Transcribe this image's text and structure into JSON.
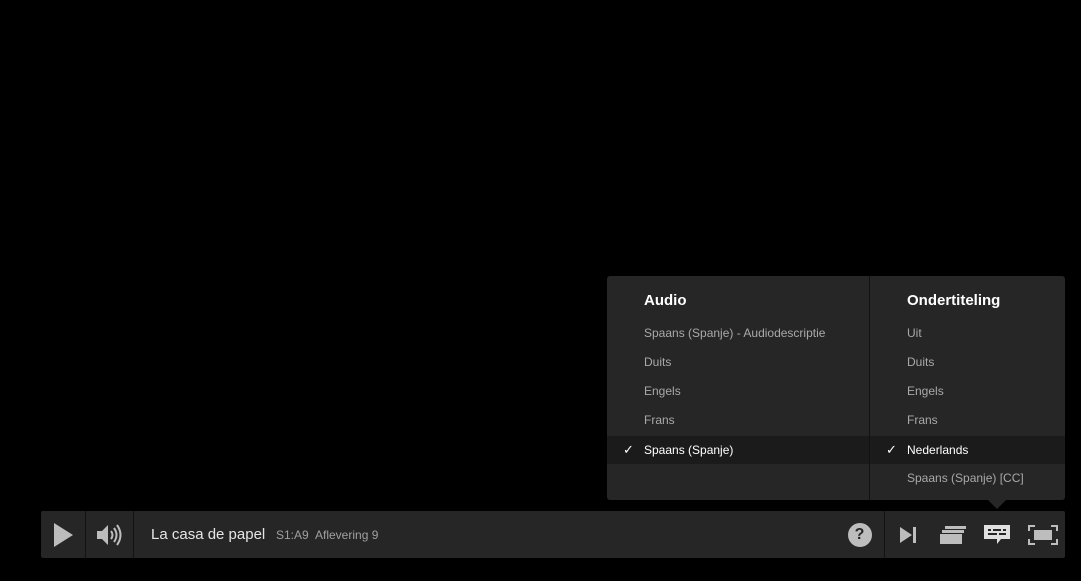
{
  "show": {
    "title": "La casa de papel",
    "episode_code": "S1:A9",
    "episode_title": "Aflevering 9"
  },
  "audio": {
    "heading": "Audio",
    "options": [
      {
        "label": "Spaans (Spanje) - Audiodescriptie",
        "selected": false
      },
      {
        "label": "Duits",
        "selected": false
      },
      {
        "label": "Engels",
        "selected": false
      },
      {
        "label": "Frans",
        "selected": false
      },
      {
        "label": "Spaans (Spanje)",
        "selected": true
      }
    ]
  },
  "subtitles": {
    "heading": "Ondertiteling",
    "options": [
      {
        "label": "Uit",
        "selected": false
      },
      {
        "label": "Duits",
        "selected": false
      },
      {
        "label": "Engels",
        "selected": false
      },
      {
        "label": "Frans",
        "selected": false
      },
      {
        "label": "Nederlands",
        "selected": true
      },
      {
        "label": "Spaans (Spanje) [CC]",
        "selected": false
      }
    ]
  },
  "icons": {
    "check": "✓",
    "help": "?"
  },
  "controls": [
    "play-icon",
    "volume-icon",
    "help-icon",
    "next-episode-icon",
    "episodes-icon",
    "subtitles-icon",
    "fullscreen-icon"
  ],
  "colors": {
    "background": "#000000",
    "panel": "#262626",
    "selected_row": "#1b1b1b",
    "icon": "#c8c8c8"
  }
}
